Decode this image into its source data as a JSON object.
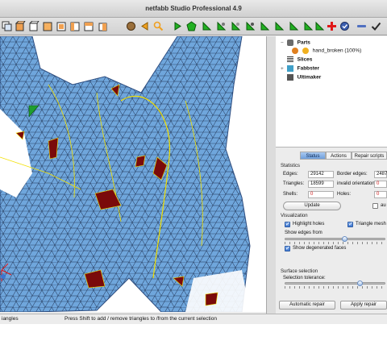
{
  "window": {
    "title": "netfabb Studio Professional 4.9"
  },
  "toolbar": {
    "icons": [
      "copy-icon",
      "cube-icon",
      "cube-outline-icon",
      "box-icon",
      "box-front-icon",
      "box-side-icon",
      "box-top-icon",
      "box-iso-icon",
      "sphere-icon",
      "arrow-left-icon",
      "zoom-icon",
      "arrow-right-icon",
      "pentagon-icon",
      "triangle-icon",
      "triangle-select-icon",
      "triangle-add-icon",
      "triangle-remove-icon",
      "triangle-invert-icon",
      "triangle-shell-icon",
      "triangle-surface-icon",
      "triangle-area-icon",
      "triangle-brush-icon",
      "plus-icon",
      "repair-icon",
      "minus-icon",
      "checkmark-icon"
    ]
  },
  "tree": {
    "parts": "Parts",
    "part_name": "hand_broken (100%)",
    "slices": "Slices",
    "fabbster": "Fabbster",
    "ultimaker": "Ultimaker"
  },
  "panel": {
    "tabs": [
      "Status",
      "Actions",
      "Repair scripts"
    ],
    "statistics_title": "Statistics",
    "edges_label": "Edges:",
    "edges_value": "29142",
    "border_edges_label": "Border edges:",
    "border_edges_value": "2487",
    "triangles_label": "Triangles:",
    "triangles_value": "18599",
    "invalid_orientation_label": "invalid orientation:",
    "invalid_orientation_value": "0",
    "shells_label": "Shells:",
    "shells_value": "0",
    "holes_label": "Holes:",
    "holes_value": "0",
    "update_button": "Update",
    "auto_label": "au",
    "visualization_title": "Visualization",
    "highlight_holes": "Highlight holes",
    "triangle_mesh": "Triangle mesh",
    "show_edges_from": "Show edges from",
    "show_degenerated": "Show degenerated faces",
    "surface_selection_title": "Surface selection",
    "selection_tolerance": "Selection tolerance:",
    "automatic_repair": "Automatic repair",
    "apply_repair": "Apply repair"
  },
  "status": {
    "left": "iangles",
    "message": "Press Shift to add / remove triangles to /from the current selection"
  },
  "colors": {
    "mesh": "#6fa6dc",
    "mesh_line": "#1b2b4a",
    "holes": "#7a0a0a",
    "highlight": "#f2e000",
    "accent": "#3d76cf"
  }
}
